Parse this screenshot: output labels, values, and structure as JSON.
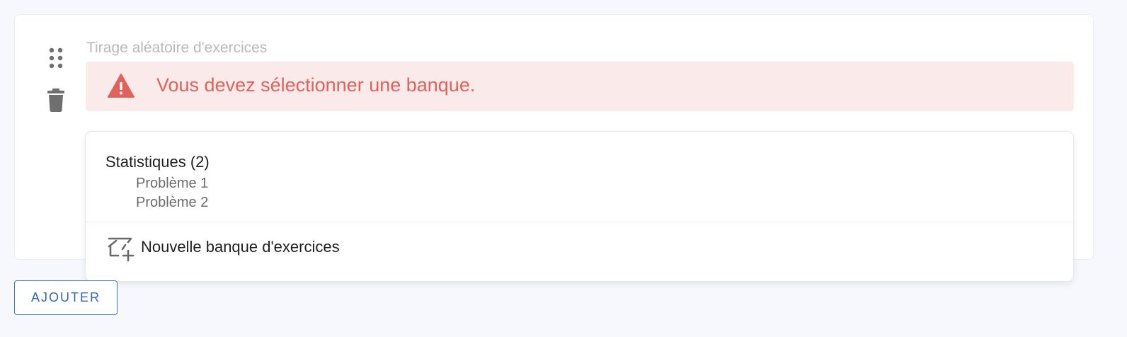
{
  "form": {
    "field_label": "Tirage aléatoire d'exercices",
    "alert": {
      "message": "Vous devez sélectionner une banque.",
      "icon": "warning-icon",
      "color": "#e0625c",
      "background": "#fbeaea"
    },
    "tools": {
      "drag_icon": "drag-handle-icon",
      "delete_icon": "trash-icon"
    }
  },
  "dropdown": {
    "group": {
      "title": "Statistiques (2)",
      "items": [
        {
          "label": "Problème 1"
        },
        {
          "label": "Problème 2"
        }
      ]
    },
    "new_bank": {
      "label": "Nouvelle banque d'exercices",
      "icon": "new-bank-icon"
    }
  },
  "actions": {
    "add_label": "AJOUTER",
    "accent": "#2f66b8"
  }
}
